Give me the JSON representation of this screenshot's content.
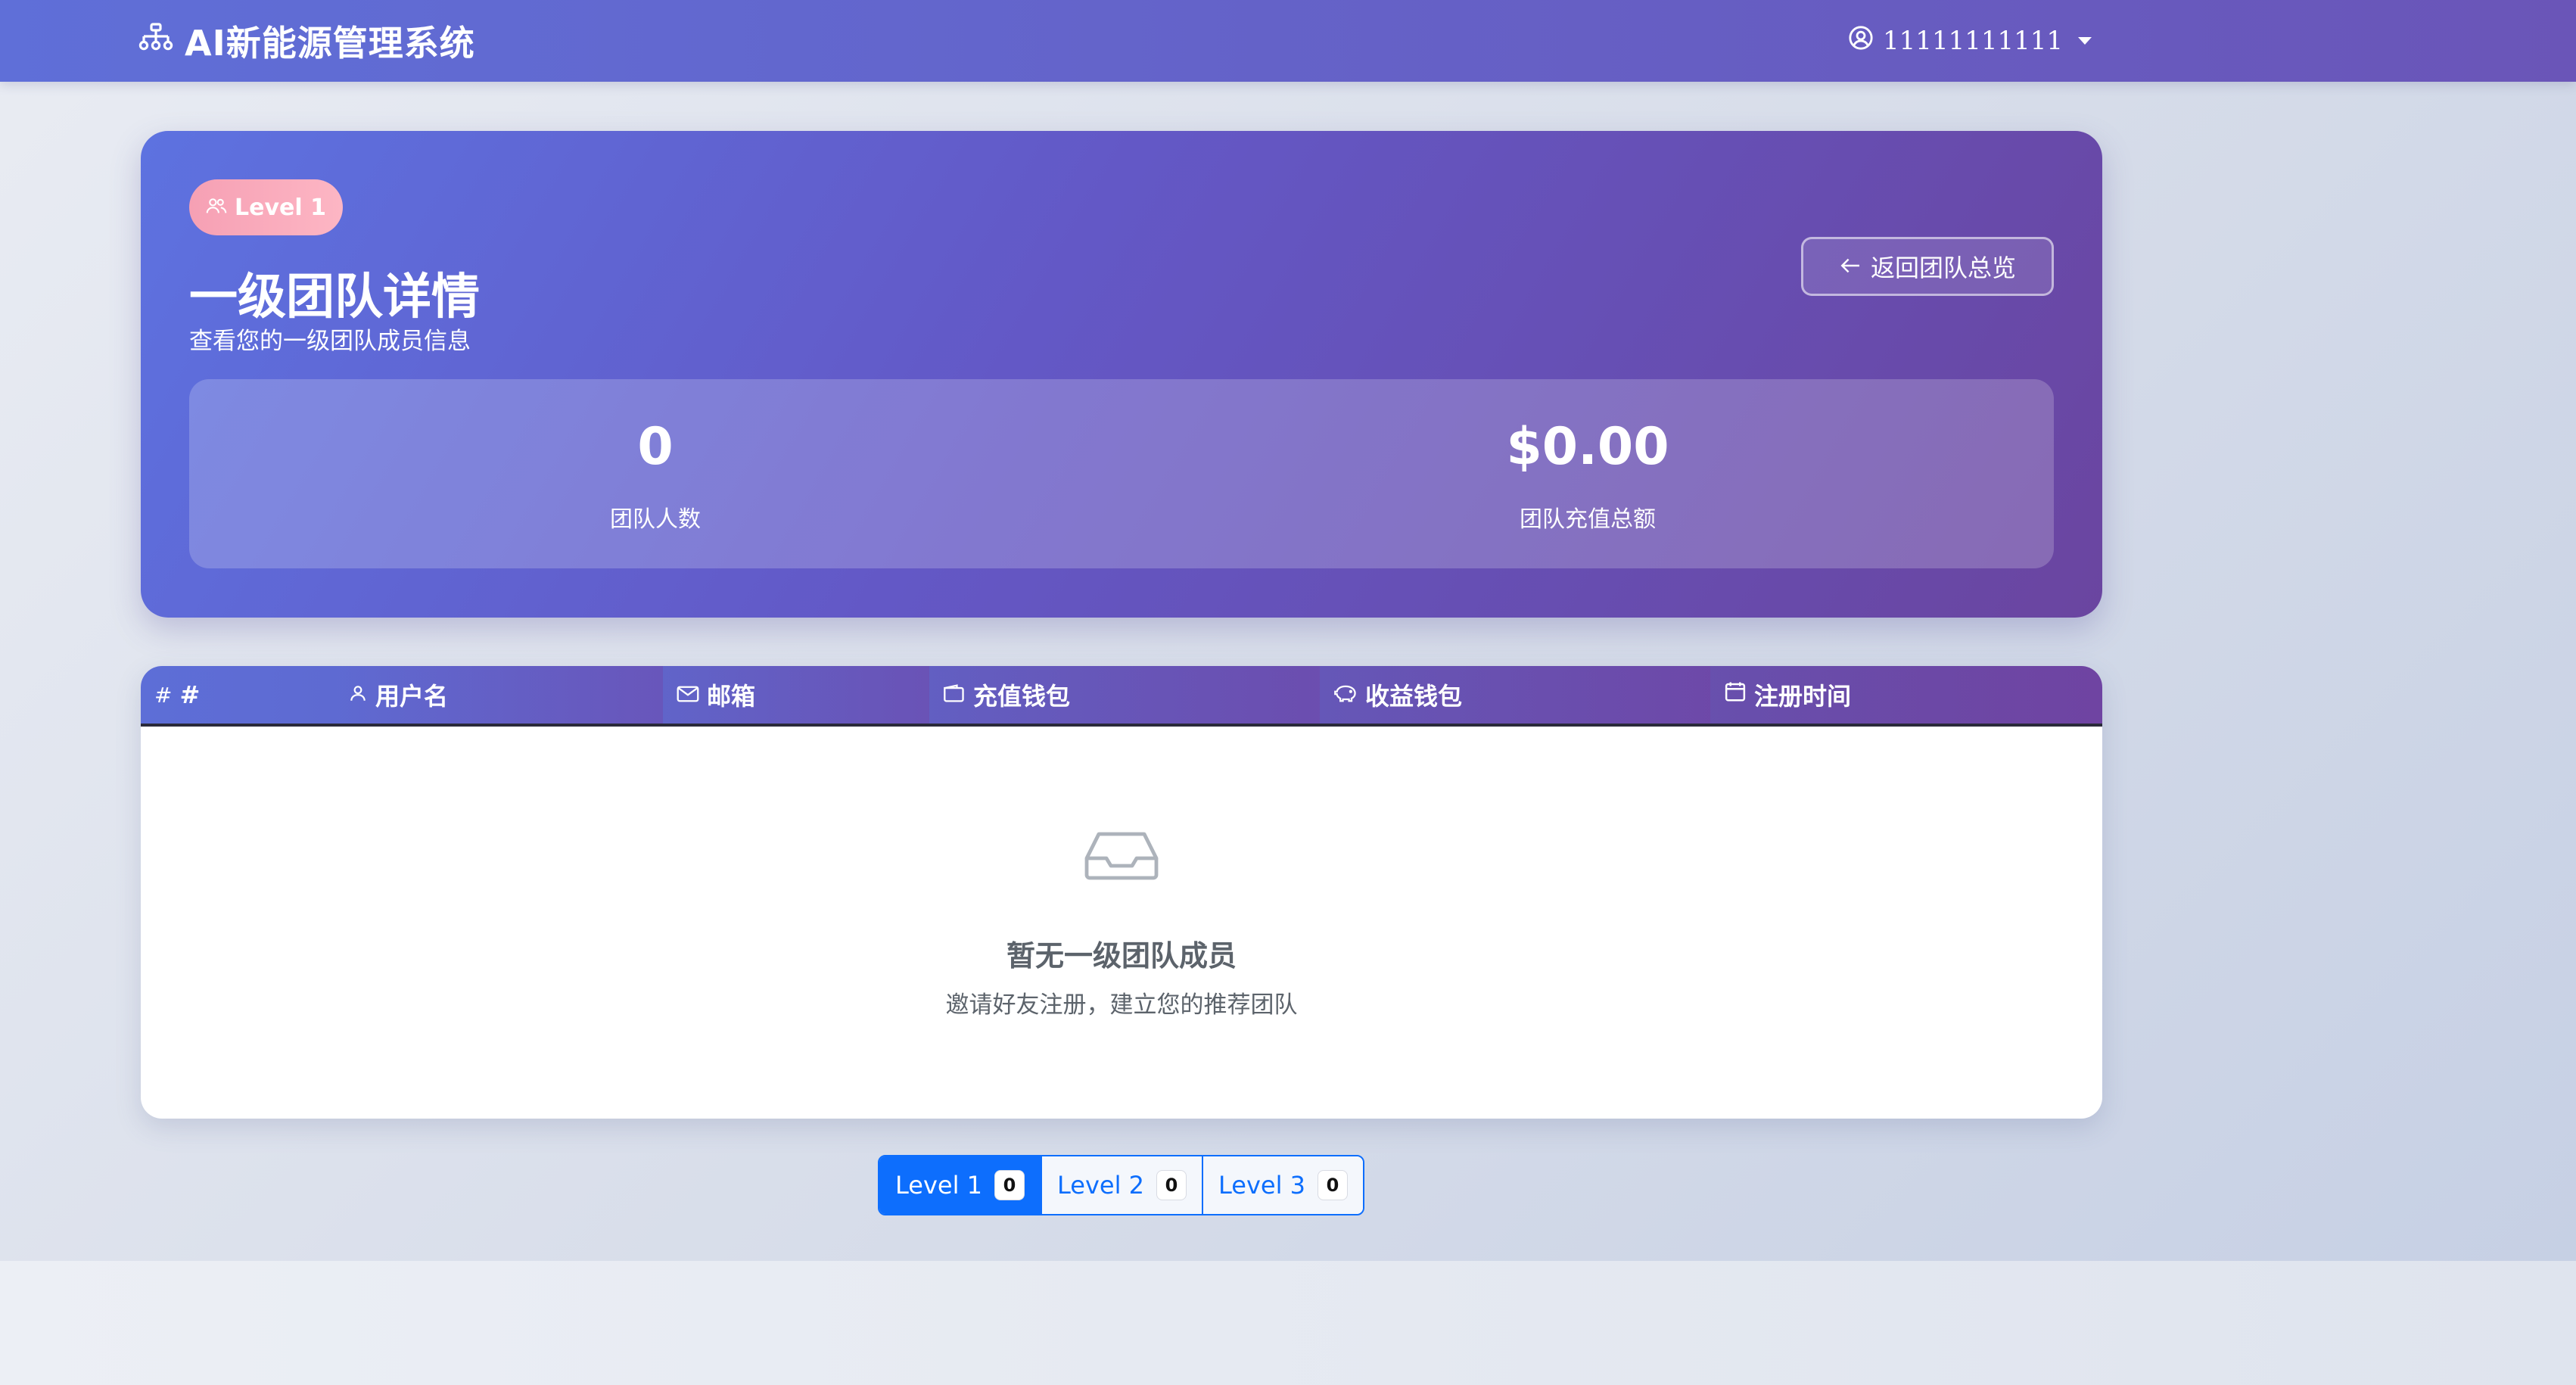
{
  "navbar": {
    "brand_icon": "sitemap-icon",
    "brand": "AI新能源管理系统",
    "user_icon": "user-circle-icon",
    "username": "11111111111"
  },
  "hero": {
    "badge_icon": "users-icon",
    "badge": "Level 1",
    "title": "一级团队详情",
    "subtitle": "查看您的一级团队成员信息",
    "back_icon": "arrow-left-icon",
    "back_button": "返回团队总览",
    "stats": [
      {
        "value": "0",
        "label": "团队人数"
      },
      {
        "value": "$0.00",
        "label": "团队充值总额"
      }
    ]
  },
  "table": {
    "columns": [
      {
        "icon": "hash-icon",
        "label": "#"
      },
      {
        "icon": "person-icon",
        "label": "用户名"
      },
      {
        "icon": "envelope-icon",
        "label": "邮箱"
      },
      {
        "icon": "wallet-icon",
        "label": "充值钱包"
      },
      {
        "icon": "piggy-bank-icon",
        "label": "收益钱包"
      },
      {
        "icon": "calendar-icon",
        "label": "注册时间"
      }
    ],
    "rows": [],
    "empty": {
      "icon": "inbox-icon",
      "title": "暂无一级团队成员",
      "description": "邀请好友注册，建立您的推荐团队"
    }
  },
  "pager": {
    "items": [
      {
        "label": "Level 1",
        "count": "0",
        "active": true
      },
      {
        "label": "Level 2",
        "count": "0",
        "active": false
      },
      {
        "label": "Level 3",
        "count": "0",
        "active": false
      }
    ]
  },
  "colors": {
    "primary": "#0d6efd",
    "nav_start": "#5f6fd8",
    "nav_end": "#6a55b8",
    "badge_pink": "#f6a0b4"
  }
}
